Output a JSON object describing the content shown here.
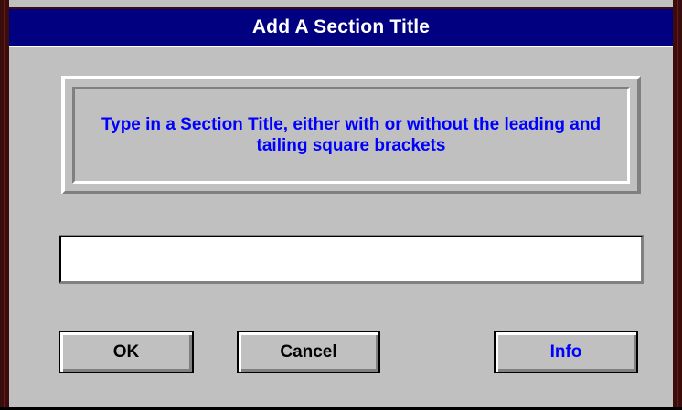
{
  "window": {
    "title": "Add A Section Title"
  },
  "message": {
    "text": "Type in a Section Title, either with or without the leading and tailing square brackets"
  },
  "input": {
    "value": "",
    "placeholder": ""
  },
  "buttons": {
    "ok_label": "OK",
    "cancel_label": "Cancel",
    "info_label": "Info"
  },
  "colors": {
    "titlebar": "#000080",
    "title_text": "#ffffff",
    "face": "#c0c0c0",
    "message_text": "#0000ff",
    "info_text": "#0000ff"
  }
}
